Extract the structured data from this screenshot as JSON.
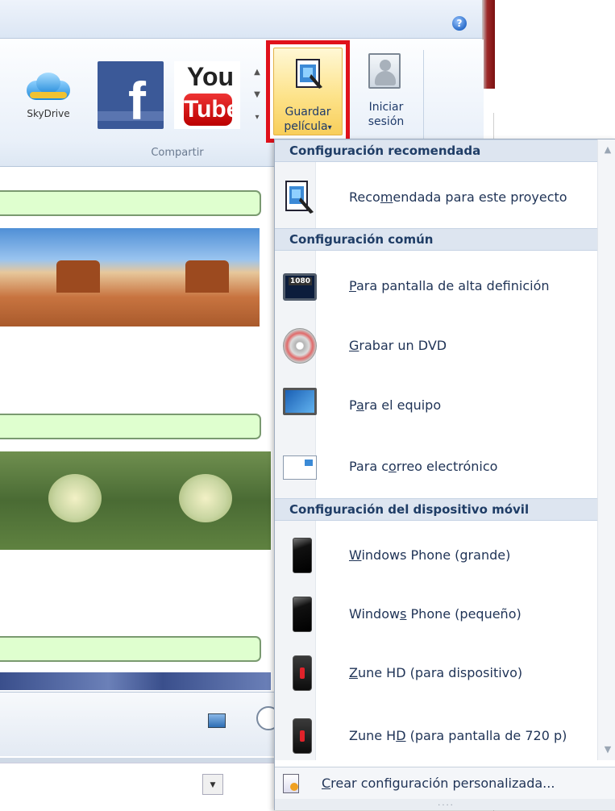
{
  "ribbon": {
    "share_group_label": "Compartir",
    "skydrive_label": "SkyDrive",
    "facebook_letter": "f",
    "youtube_top": "You",
    "youtube_bottom": "Tube",
    "save_movie_label_1": "Guardar",
    "save_movie_label_2": "película",
    "save_movie_arrow": "▾",
    "sign_in_label_1": "Iniciar",
    "sign_in_label_2": "sesión",
    "help_glyph": "?",
    "gallery_up": "▲",
    "gallery_down": "▼",
    "gallery_more": "▾"
  },
  "menu": {
    "section_recommended": "Configuración recomendada",
    "recommended_item": {
      "pre": "Reco",
      "acc": "m",
      "post": "endada para este proyecto"
    },
    "section_common": "Configuración común",
    "common_items": [
      {
        "pre": "",
        "acc": "P",
        "post": "ara pantalla de alta definición",
        "icon": "hd-monitor-icon",
        "badge": "1080"
      },
      {
        "pre": "",
        "acc": "G",
        "post": "rabar un DVD",
        "icon": "dvd-icon"
      },
      {
        "pre": "P",
        "acc": "a",
        "post": "ra el equipo",
        "icon": "computer-icon"
      },
      {
        "pre": "Para c",
        "acc": "o",
        "post": "rreo electrónico",
        "icon": "email-icon"
      }
    ],
    "section_mobile": "Configuración del dispositivo móvil",
    "mobile_items": [
      {
        "pre": "",
        "acc": "W",
        "post": "indows Phone (grande)",
        "icon": "windows-phone-icon"
      },
      {
        "pre": "Window",
        "acc": "s",
        "post": " Phone (pequeño)",
        "icon": "windows-phone-icon"
      },
      {
        "pre": "",
        "acc": "Z",
        "post": "une HD (para dispositivo)",
        "icon": "zune-icon"
      },
      {
        "pre": "Zune H",
        "acc": "D",
        "post": " (para pantalla de 720 p)",
        "icon": "zune-icon"
      }
    ],
    "footer": {
      "pre": "",
      "acc": "C",
      "post": "rear configuración personalizada..."
    },
    "scroll_up": "▲",
    "scroll_down": "▼",
    "grip": "....",
    "combo_arrow": "▼"
  }
}
